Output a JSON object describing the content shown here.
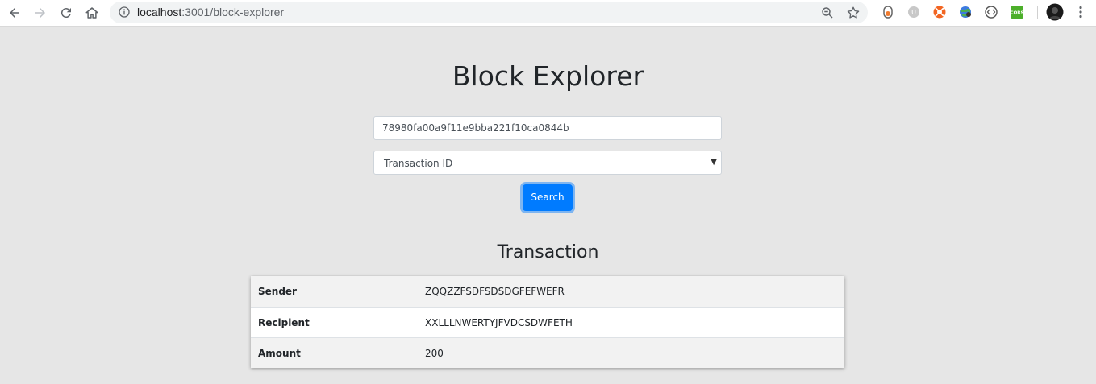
{
  "browser": {
    "url_host": "localhost",
    "url_path": ":3001/block-explorer",
    "extensions": [
      "ext-timer-icon",
      "ext-ublock-icon",
      "ext-lifebuoy-icon",
      "ext-globe-icon",
      "ext-code-icon",
      "ext-cors-icon"
    ],
    "cors_label": "CORS"
  },
  "page": {
    "title": "Block Explorer",
    "search": {
      "value": "78980fa00a9f11e9bba221f10ca0844b",
      "type_selected": "Transaction ID",
      "button_label": "Search"
    },
    "section_title": "Transaction",
    "transaction": [
      {
        "key": "Sender",
        "value": "ZQQZZFSDFSDSDGFEFWEFR"
      },
      {
        "key": "Recipient",
        "value": "XXLLLNWERTYJFVDCSDWFETH"
      },
      {
        "key": "Amount",
        "value": "200"
      }
    ]
  },
  "colors": {
    "primary": "#007bff",
    "background": "#e6e6e6"
  }
}
